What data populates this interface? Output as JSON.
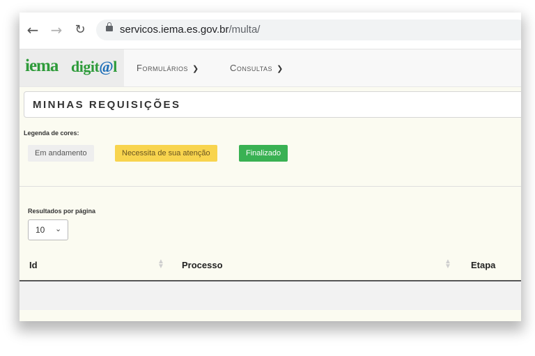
{
  "browser": {
    "back_icon": "arrow-left-icon",
    "forward_icon": "arrow-right-icon",
    "reload_icon": "reload-icon",
    "url_host": "servicos.iema.es.gov.br",
    "url_path": "/multa/"
  },
  "header": {
    "logo_part1": "iema",
    "logo_part2a": "digit",
    "logo_part2b": "@",
    "logo_part2c": "l",
    "menu": [
      {
        "label": "Formulários"
      },
      {
        "label": "Consultas"
      }
    ]
  },
  "page": {
    "title": "MINHAS REQUISIÇÕES",
    "legend_title": "Legenda de cores:",
    "legend": [
      {
        "label": "Em andamento",
        "color": "#eeeeee"
      },
      {
        "label": "Necessita de sua atenção",
        "color": "#f8d44e"
      },
      {
        "label": "Finalizado",
        "color": "#39b153"
      }
    ],
    "results_per_page_label": "Resultados por página",
    "results_per_page_value": "10",
    "table": {
      "columns": [
        "Id",
        "Processo",
        "Etapa"
      ]
    }
  }
}
